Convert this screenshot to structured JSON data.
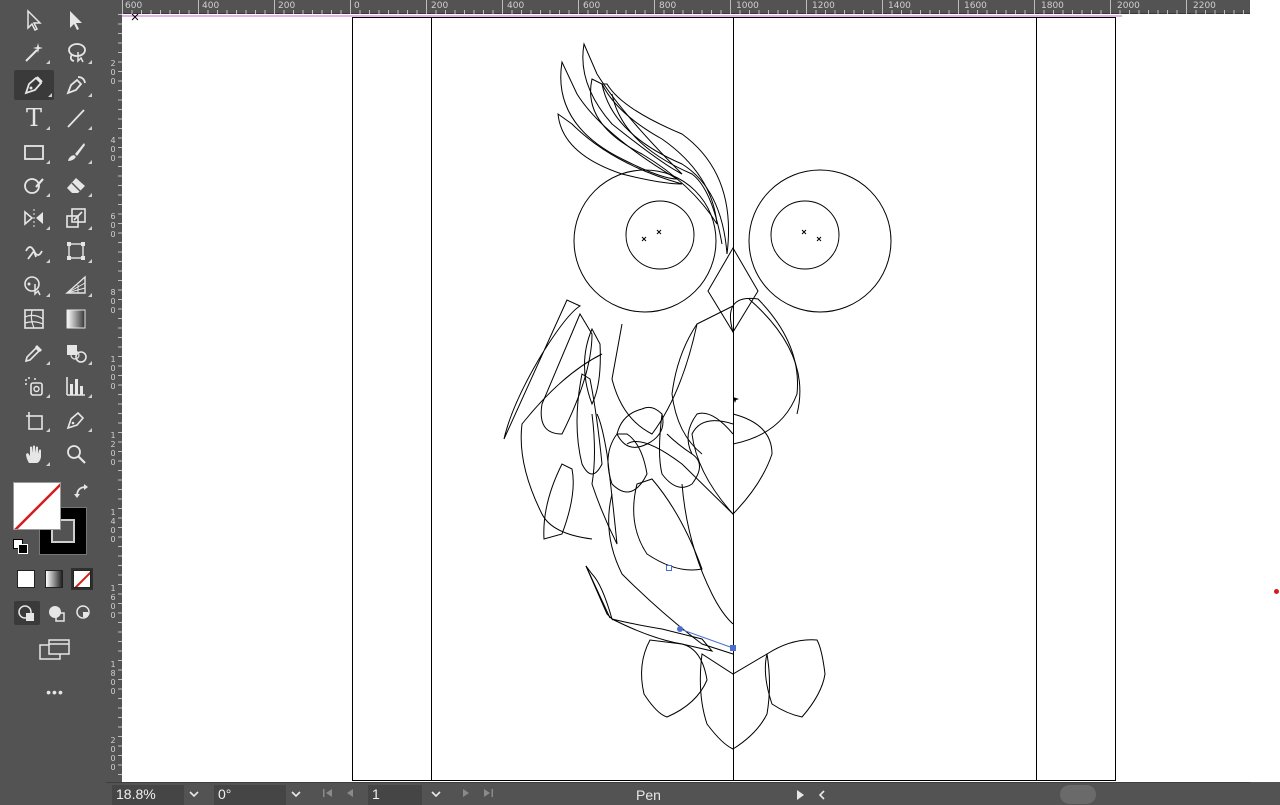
{
  "toolbar": {
    "tools": [
      {
        "id": "selection",
        "icon": "selection-arrow-icon"
      },
      {
        "id": "direct-selection",
        "icon": "direct-selection-icon"
      },
      {
        "id": "magic-wand",
        "icon": "magic-wand-icon"
      },
      {
        "id": "lasso",
        "icon": "lasso-icon"
      },
      {
        "id": "pen",
        "icon": "pen-icon",
        "active": true
      },
      {
        "id": "curvature",
        "icon": "curvature-icon"
      },
      {
        "id": "type",
        "icon": "type-icon"
      },
      {
        "id": "line",
        "icon": "line-icon"
      },
      {
        "id": "rectangle",
        "icon": "rectangle-icon"
      },
      {
        "id": "paintbrush",
        "icon": "paintbrush-icon"
      },
      {
        "id": "shaper",
        "icon": "shaper-icon"
      },
      {
        "id": "eraser",
        "icon": "eraser-icon"
      },
      {
        "id": "reflect",
        "icon": "reflect-icon"
      },
      {
        "id": "scale",
        "icon": "scale-icon"
      },
      {
        "id": "warp",
        "icon": "warp-icon"
      },
      {
        "id": "free-transform",
        "icon": "free-transform-icon"
      },
      {
        "id": "shape-builder",
        "icon": "shape-builder-icon"
      },
      {
        "id": "perspective-grid",
        "icon": "perspective-grid-icon"
      },
      {
        "id": "mesh",
        "icon": "mesh-icon"
      },
      {
        "id": "gradient",
        "icon": "gradient-icon"
      },
      {
        "id": "eyedropper",
        "icon": "eyedropper-icon"
      },
      {
        "id": "blend",
        "icon": "blend-icon"
      },
      {
        "id": "symbol-sprayer",
        "icon": "symbol-sprayer-icon"
      },
      {
        "id": "column-graph",
        "icon": "column-graph-icon"
      },
      {
        "id": "artboard",
        "icon": "artboard-icon"
      },
      {
        "id": "slice",
        "icon": "slice-icon"
      },
      {
        "id": "hand",
        "icon": "hand-icon"
      },
      {
        "id": "zoom",
        "icon": "zoom-icon"
      }
    ],
    "type_tool_glyph": "T",
    "more_glyph": "•••"
  },
  "ruler": {
    "top_labels": [
      "600",
      "400",
      "200",
      "0",
      "200",
      "400",
      "600",
      "800",
      "1000",
      "1200",
      "1400",
      "1600",
      "1800",
      "2000",
      "2200"
    ],
    "left_labels": [
      "2\n0\n0",
      "4\n0\n0",
      "6\n0\n0",
      "8\n0\n0",
      "1\n0\n0\n0",
      "1\n2\n0\n0",
      "1\n4\n0\n0",
      "1\n6\n0\n0",
      "1\n8\n0\n0",
      "2\n0\n0\n0"
    ]
  },
  "statusbar": {
    "zoom": "18.8%",
    "rotation": "0°",
    "artboard_number": "1",
    "current_tool": "Pen"
  },
  "colors": {
    "ui_bg": "#535353",
    "panel_dark": "#3a3a3a",
    "canvas": "#ffffff",
    "anchor_blue": "#4a6fd1",
    "artboard_guide_pink": "#d65fd6",
    "no_fill_red": "#d41c1c"
  }
}
